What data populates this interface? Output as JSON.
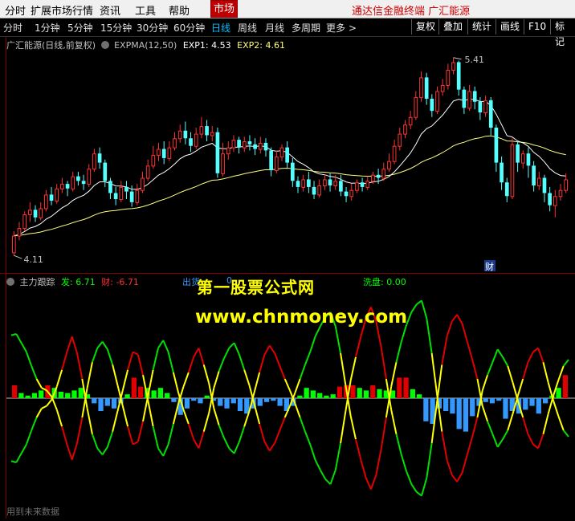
{
  "menu": {
    "items": [
      "分时",
      "扩展市场行情",
      "资讯",
      "工具",
      "帮助"
    ],
    "market_label": "市场",
    "brand": "通达信金融终端  广汇能源"
  },
  "toolbar": {
    "periods": [
      "分时",
      "1分钟",
      "5分钟",
      "15分钟",
      "30分钟",
      "60分钟",
      "日线",
      "周线",
      "月线",
      "多周期",
      "更多 >"
    ],
    "active_period": "日线",
    "right_buttons": [
      "复权",
      "叠加",
      "统计",
      "画线",
      "F10",
      "标记"
    ]
  },
  "main_chart": {
    "title": "广汇能源(日线,前复权)",
    "indicator": "EXPMA(12,50)",
    "exp1_label": "EXP1: 4.53",
    "exp2_label": "EXP2: 4.61",
    "high_label": "5.41",
    "low_label": "4.11",
    "marker": "财",
    "colors": {
      "up": "#ff3232",
      "down": "#54ffff",
      "exp1": "#ffffff",
      "exp2": "#ffff80"
    }
  },
  "sub_chart": {
    "title": "主力跟踪",
    "fa_label": "发: 6.71",
    "cai_label": "财: -6.71",
    "chuhuo_label": "出货",
    "xipan_label": "洗盘: 0.00",
    "zero_label": "0",
    "colors": {
      "fa": "#00ff00",
      "cai": "#ff3030",
      "xipan": "#00ff00",
      "chuhuo": "#3399ff"
    }
  },
  "watermark": {
    "line1": "第一股票公式网",
    "line2": "www.chnmoney.com"
  },
  "footer_text": "用到未来数据",
  "chart_data": {
    "type": "candlestick",
    "title": "广汇能源(日线,前复权)",
    "price_high": 5.41,
    "price_low": 4.11,
    "exp1_last": 4.53,
    "exp2_last": 4.61,
    "candles": [
      [
        4.13,
        4.24,
        4.11,
        4.27
      ],
      [
        4.24,
        4.29,
        4.21,
        4.33
      ],
      [
        4.29,
        4.38,
        4.27,
        4.4
      ],
      [
        4.38,
        4.41,
        4.33,
        4.46
      ],
      [
        4.41,
        4.36,
        4.33,
        4.44
      ],
      [
        4.36,
        4.42,
        4.34,
        4.46
      ],
      [
        4.42,
        4.51,
        4.4,
        4.54
      ],
      [
        4.51,
        4.47,
        4.44,
        4.56
      ],
      [
        4.47,
        4.55,
        4.45,
        4.58
      ],
      [
        4.55,
        4.58,
        4.52,
        4.62
      ],
      [
        4.58,
        4.55,
        4.5,
        4.6
      ],
      [
        4.55,
        4.63,
        4.53,
        4.66
      ],
      [
        4.63,
        4.6,
        4.57,
        4.66
      ],
      [
        4.6,
        4.58,
        4.54,
        4.64
      ],
      [
        4.58,
        4.68,
        4.56,
        4.71
      ],
      [
        4.68,
        4.78,
        4.66,
        4.81
      ],
      [
        4.78,
        4.72,
        4.68,
        4.82
      ],
      [
        4.72,
        4.6,
        4.56,
        4.74
      ],
      [
        4.6,
        4.52,
        4.48,
        4.62
      ],
      [
        4.52,
        4.48,
        4.44,
        4.56
      ],
      [
        4.48,
        4.56,
        4.46,
        4.6
      ],
      [
        4.56,
        4.53,
        4.48,
        4.6
      ],
      [
        4.53,
        4.46,
        4.43,
        4.57
      ],
      [
        4.46,
        4.54,
        4.44,
        4.58
      ],
      [
        4.54,
        4.62,
        4.52,
        4.66
      ],
      [
        4.62,
        4.7,
        4.6,
        4.74
      ],
      [
        4.7,
        4.77,
        4.68,
        4.83
      ],
      [
        4.77,
        4.81,
        4.73,
        4.85
      ],
      [
        4.81,
        4.75,
        4.71,
        4.86
      ],
      [
        4.75,
        4.82,
        4.73,
        4.86
      ],
      [
        4.82,
        4.88,
        4.8,
        4.92
      ],
      [
        4.88,
        4.93,
        4.85,
        4.97
      ],
      [
        4.93,
        4.88,
        4.84,
        4.99
      ],
      [
        4.88,
        4.83,
        4.79,
        4.92
      ],
      [
        4.83,
        4.91,
        4.81,
        4.95
      ],
      [
        4.91,
        4.96,
        4.88,
        5.02
      ],
      [
        4.96,
        4.9,
        4.86,
        5.0
      ],
      [
        4.9,
        4.92,
        4.86,
        4.96
      ],
      [
        4.92,
        4.65,
        4.62,
        4.95
      ],
      [
        4.65,
        4.78,
        4.63,
        4.85
      ],
      [
        4.78,
        4.82,
        4.74,
        4.86
      ],
      [
        4.82,
        4.87,
        4.79,
        4.9
      ],
      [
        4.87,
        4.82,
        4.78,
        4.89
      ],
      [
        4.82,
        4.86,
        4.79,
        4.89
      ],
      [
        4.86,
        4.84,
        4.8,
        4.9
      ],
      [
        4.84,
        4.81,
        4.77,
        4.88
      ],
      [
        4.81,
        4.85,
        4.78,
        4.89
      ],
      [
        4.85,
        4.8,
        4.76,
        4.88
      ],
      [
        4.8,
        4.67,
        4.63,
        4.82
      ],
      [
        4.67,
        4.76,
        4.65,
        4.8
      ],
      [
        4.76,
        4.82,
        4.73,
        4.84
      ],
      [
        4.82,
        4.72,
        4.68,
        4.86
      ],
      [
        4.72,
        4.6,
        4.56,
        4.75
      ],
      [
        4.6,
        4.56,
        4.52,
        4.63
      ],
      [
        4.56,
        4.61,
        4.53,
        4.64
      ],
      [
        4.61,
        4.56,
        4.52,
        4.66
      ],
      [
        4.56,
        4.51,
        4.48,
        4.6
      ],
      [
        4.51,
        4.57,
        4.49,
        4.61
      ],
      [
        4.57,
        4.61,
        4.54,
        4.64
      ],
      [
        4.61,
        4.57,
        4.53,
        4.65
      ],
      [
        4.57,
        4.6,
        4.54,
        4.64
      ],
      [
        4.6,
        4.53,
        4.5,
        4.64
      ],
      [
        4.53,
        4.5,
        4.46,
        4.56
      ],
      [
        4.5,
        4.54,
        4.47,
        4.58
      ],
      [
        4.54,
        4.59,
        4.52,
        4.61
      ],
      [
        4.59,
        4.56,
        4.53,
        4.62
      ],
      [
        4.56,
        4.6,
        4.54,
        4.63
      ],
      [
        4.6,
        4.64,
        4.58,
        4.66
      ],
      [
        4.64,
        4.62,
        4.58,
        4.68
      ],
      [
        4.62,
        4.68,
        4.6,
        4.72
      ],
      [
        4.68,
        4.73,
        4.66,
        4.78
      ],
      [
        4.73,
        4.83,
        4.71,
        4.87
      ],
      [
        4.83,
        4.91,
        4.8,
        4.95
      ],
      [
        4.91,
        4.97,
        4.88,
        5.0
      ],
      [
        4.97,
        5.02,
        4.94,
        5.06
      ],
      [
        5.02,
        5.15,
        5.0,
        5.19
      ],
      [
        5.15,
        5.28,
        5.12,
        5.32
      ],
      [
        5.28,
        5.14,
        5.1,
        5.31
      ],
      [
        5.14,
        5.06,
        5.02,
        5.17
      ],
      [
        5.06,
        5.19,
        5.04,
        5.22
      ],
      [
        5.19,
        5.23,
        5.16,
        5.27
      ],
      [
        5.23,
        5.33,
        5.2,
        5.37
      ],
      [
        5.33,
        5.38,
        5.3,
        5.41
      ],
      [
        5.38,
        5.2,
        5.16,
        5.39
      ],
      [
        5.2,
        5.08,
        5.04,
        5.22
      ],
      [
        5.08,
        5.19,
        5.06,
        5.23
      ],
      [
        5.19,
        5.12,
        5.07,
        5.22
      ],
      [
        5.12,
        5.05,
        5.0,
        5.15
      ],
      [
        5.05,
        5.13,
        5.02,
        5.16
      ],
      [
        5.13,
        4.95,
        4.9,
        5.15
      ],
      [
        4.95,
        4.72,
        4.66,
        4.97
      ],
      [
        4.72,
        4.59,
        4.54,
        4.76
      ],
      [
        4.59,
        4.5,
        4.46,
        4.62
      ],
      [
        4.5,
        4.84,
        4.48,
        4.88
      ],
      [
        4.84,
        4.72,
        4.66,
        4.86
      ],
      [
        4.72,
        4.78,
        4.68,
        4.8
      ],
      [
        4.78,
        4.7,
        4.62,
        4.82
      ],
      [
        4.7,
        4.57,
        4.53,
        4.73
      ],
      [
        4.57,
        4.62,
        4.54,
        4.66
      ],
      [
        4.62,
        4.52,
        4.46,
        4.64
      ],
      [
        4.52,
        4.44,
        4.4,
        4.56
      ],
      [
        4.44,
        4.5,
        4.36,
        4.54
      ],
      [
        4.5,
        4.54,
        4.47,
        4.58
      ],
      [
        4.54,
        4.61,
        4.52,
        4.65
      ]
    ],
    "fa_series": [
      4.9,
      5.0,
      4.3,
      3.6,
      2.5,
      1.5,
      0.8,
      0.6,
      0.1,
      -0.9,
      -2.2,
      -3.6,
      -4.8,
      -3.5,
      -1.5,
      0.8,
      2.8,
      3.9,
      4.4,
      3.8,
      2.6,
      1.0,
      -0.6,
      -2.2,
      -3.6,
      -3.4,
      -1.8,
      0.2,
      2.2,
      3.9,
      4.5,
      3.6,
      2.0,
      0.4,
      -0.9,
      -2.0,
      -3.2,
      -3.9,
      -2.6,
      -1.2,
      0.8,
      2.1,
      3.1,
      3.9,
      4.3,
      3.4,
      2.2,
      1.0,
      -0.5,
      -2.0,
      -3.4,
      -4.1,
      -3.5,
      -2.5,
      -1.5,
      -0.6,
      0.4,
      1.5,
      2.6,
      3.6,
      4.8,
      5.6,
      6.3,
      6.7,
      5.6,
      3.5,
      1.0,
      -1.4,
      -3.2,
      -4.8,
      -6.2,
      -7.1,
      -6.0,
      -4.0,
      -1.5,
      0.9,
      2.8,
      4.4,
      5.7,
      6.7,
      7.3,
      7.6,
      6.2,
      3.5,
      0.4,
      -2.6,
      -4.8,
      -6.0,
      -6.5,
      -5.8,
      -4.4,
      -3.0,
      -1.5,
      0.6,
      1.8,
      2.8,
      3.8,
      3.2,
      2.5,
      1.2,
      -0.2,
      -1.5,
      -2.8,
      -3.6,
      -3.9,
      -2.8,
      -1.2,
      0.2,
      1.4,
      2.5,
      3.0
    ],
    "bars": [
      1.0,
      0.4,
      0.2,
      0.4,
      0.6,
      1.0,
      0.8,
      0.5,
      0.4,
      0.6,
      0.8,
      0.3,
      -0.4,
      -1.0,
      -0.6,
      -0.8,
      -0.4,
      0.3,
      1.6,
      0.9,
      0.8,
      0.6,
      0.8,
      0.4,
      -0.3,
      -1.3,
      -0.8,
      -0.2,
      -0.4,
      0.2,
      -0.2,
      -0.6,
      -0.8,
      -0.4,
      -1.0,
      -1.2,
      -0.8,
      -0.6,
      -0.3,
      -0.2,
      -0.6,
      -1.0,
      -0.6,
      0.2,
      0.8,
      0.6,
      0.4,
      0.2,
      0.3,
      0.9,
      1.0,
      1.0,
      0.8,
      0.6,
      1.0,
      0.7,
      0.6,
      0.6,
      1.6,
      1.6,
      0.7,
      0.3,
      -1.8,
      -2.0,
      -0.8,
      -1.0,
      -1.2,
      -2.4,
      -2.6,
      -1.4,
      -0.6,
      -0.3,
      -0.4,
      -0.2,
      -1.6,
      -1.0,
      -1.2,
      -0.9,
      -0.6,
      -1.2,
      -0.4,
      0.2,
      0.8,
      1.8
    ]
  }
}
